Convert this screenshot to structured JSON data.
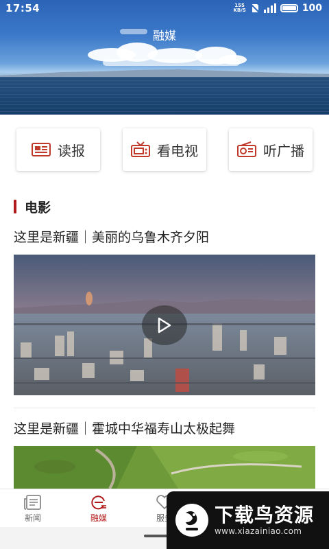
{
  "status_bar": {
    "time": "17:54",
    "net_speed_value": "155",
    "net_speed_unit": "KB/S",
    "signal": "4G",
    "battery": "100"
  },
  "hero": {
    "title": "融媒"
  },
  "quick_actions": [
    {
      "label": "读报",
      "icon": "newspaper-icon"
    },
    {
      "label": "看电视",
      "icon": "tv-icon"
    },
    {
      "label": "听广播",
      "icon": "radio-icon"
    }
  ],
  "section": {
    "title": "电影"
  },
  "articles": [
    {
      "title": "这里是新疆｜美丽的乌鲁木齐夕阳"
    },
    {
      "title": "这里是新疆｜霍城中华福寿山太极起舞"
    }
  ],
  "tab_bar": {
    "items": [
      {
        "label": "新闻",
        "icon": "newspaper-tab-icon",
        "active": false
      },
      {
        "label": "融媒",
        "icon": "media-e-icon",
        "active": true
      },
      {
        "label": "服务",
        "icon": "heart-icon",
        "active": false
      },
      {
        "label": "",
        "icon": "chat-icon",
        "active": false
      },
      {
        "label": "",
        "icon": "users-icon",
        "active": false
      }
    ]
  },
  "watermark": {
    "text": "下载鸟资源",
    "url": "www.xiazainiao.com"
  },
  "colors": {
    "accent": "#b21b1b",
    "text": "#222222"
  }
}
